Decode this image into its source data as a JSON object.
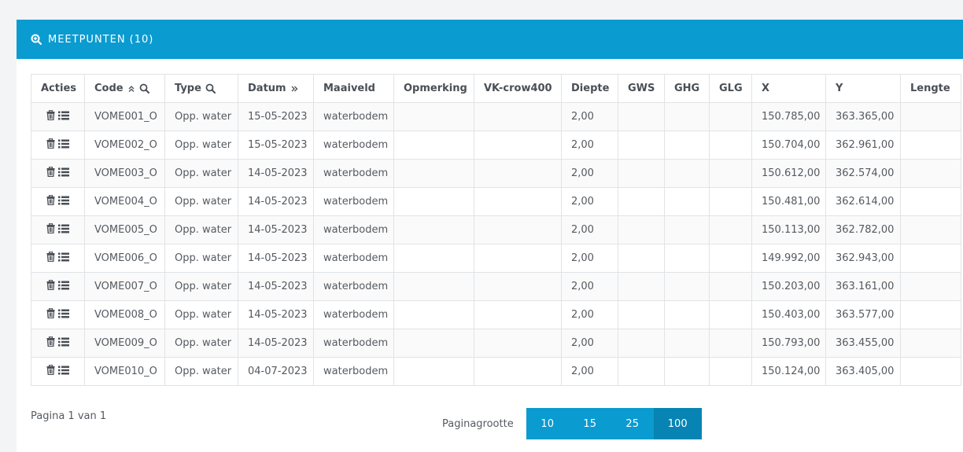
{
  "panel": {
    "title": "MEETPUNTEN (10)"
  },
  "table": {
    "headers": {
      "acties": "Acties",
      "code": "Code",
      "type": "Type",
      "datum": "Datum",
      "maaiveld": "Maaiveld",
      "opmerking": "Opmerking",
      "vk": "VK-crow400",
      "diepte": "Diepte",
      "gws": "GWS",
      "ghg": "GHG",
      "glg": "GLG",
      "x": "X",
      "y": "Y",
      "lengte": "Lengte"
    },
    "rows": [
      {
        "code": "VOME001_O",
        "type": "Opp. water",
        "datum": "15-05-2023",
        "maaiveld": "waterbodem",
        "opmerking": "",
        "vk": "",
        "diepte": "2,00",
        "gws": "",
        "ghg": "",
        "glg": "",
        "x": "150.785,00",
        "y": "363.365,00",
        "lengte": ""
      },
      {
        "code": "VOME002_O",
        "type": "Opp. water",
        "datum": "15-05-2023",
        "maaiveld": "waterbodem",
        "opmerking": "",
        "vk": "",
        "diepte": "2,00",
        "gws": "",
        "ghg": "",
        "glg": "",
        "x": "150.704,00",
        "y": "362.961,00",
        "lengte": ""
      },
      {
        "code": "VOME003_O",
        "type": "Opp. water",
        "datum": "14-05-2023",
        "maaiveld": "waterbodem",
        "opmerking": "",
        "vk": "",
        "diepte": "2,00",
        "gws": "",
        "ghg": "",
        "glg": "",
        "x": "150.612,00",
        "y": "362.574,00",
        "lengte": ""
      },
      {
        "code": "VOME004_O",
        "type": "Opp. water",
        "datum": "14-05-2023",
        "maaiveld": "waterbodem",
        "opmerking": "",
        "vk": "",
        "diepte": "2,00",
        "gws": "",
        "ghg": "",
        "glg": "",
        "x": "150.481,00",
        "y": "362.614,00",
        "lengte": ""
      },
      {
        "code": "VOME005_O",
        "type": "Opp. water",
        "datum": "14-05-2023",
        "maaiveld": "waterbodem",
        "opmerking": "",
        "vk": "",
        "diepte": "2,00",
        "gws": "",
        "ghg": "",
        "glg": "",
        "x": "150.113,00",
        "y": "362.782,00",
        "lengte": ""
      },
      {
        "code": "VOME006_O",
        "type": "Opp. water",
        "datum": "14-05-2023",
        "maaiveld": "waterbodem",
        "opmerking": "",
        "vk": "",
        "diepte": "2,00",
        "gws": "",
        "ghg": "",
        "glg": "",
        "x": "149.992,00",
        "y": "362.943,00",
        "lengte": ""
      },
      {
        "code": "VOME007_O",
        "type": "Opp. water",
        "datum": "14-05-2023",
        "maaiveld": "waterbodem",
        "opmerking": "",
        "vk": "",
        "diepte": "2,00",
        "gws": "",
        "ghg": "",
        "glg": "",
        "x": "150.203,00",
        "y": "363.161,00",
        "lengte": ""
      },
      {
        "code": "VOME008_O",
        "type": "Opp. water",
        "datum": "14-05-2023",
        "maaiveld": "waterbodem",
        "opmerking": "",
        "vk": "",
        "diepte": "2,00",
        "gws": "",
        "ghg": "",
        "glg": "",
        "x": "150.403,00",
        "y": "363.577,00",
        "lengte": ""
      },
      {
        "code": "VOME009_O",
        "type": "Opp. water",
        "datum": "14-05-2023",
        "maaiveld": "waterbodem",
        "opmerking": "",
        "vk": "",
        "diepte": "2,00",
        "gws": "",
        "ghg": "",
        "glg": "",
        "x": "150.793,00",
        "y": "363.455,00",
        "lengte": ""
      },
      {
        "code": "VOME010_O",
        "type": "Opp. water",
        "datum": "04-07-2023",
        "maaiveld": "waterbodem",
        "opmerking": "",
        "vk": "",
        "diepte": "2,00",
        "gws": "",
        "ghg": "",
        "glg": "",
        "x": "150.124,00",
        "y": "363.405,00",
        "lengte": ""
      }
    ]
  },
  "footer": {
    "page_info": "Pagina 1 van 1",
    "page_size_label": "Paginagrootte",
    "page_sizes": [
      "10",
      "15",
      "25",
      "100"
    ],
    "active_page_size": "100"
  },
  "colors": {
    "accent": "#0a9bd0",
    "accent_active": "#0784b3"
  }
}
